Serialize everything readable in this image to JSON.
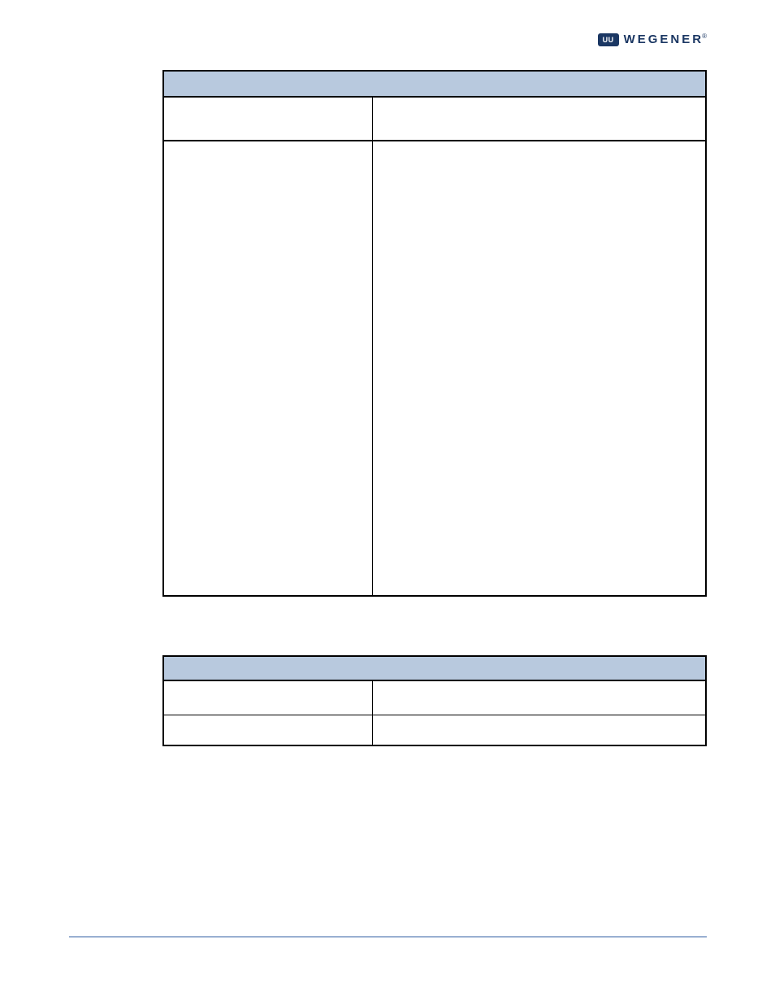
{
  "logo": {
    "mark_text": "UU",
    "text": "WEGENER",
    "registered": "®"
  },
  "table1": {
    "header": "",
    "rows": [
      {
        "left": "",
        "right": ""
      },
      {
        "left": "",
        "right": ""
      }
    ]
  },
  "table2": {
    "header": "",
    "rows": [
      {
        "left": "",
        "right": ""
      },
      {
        "left": "",
        "right": ""
      }
    ]
  }
}
